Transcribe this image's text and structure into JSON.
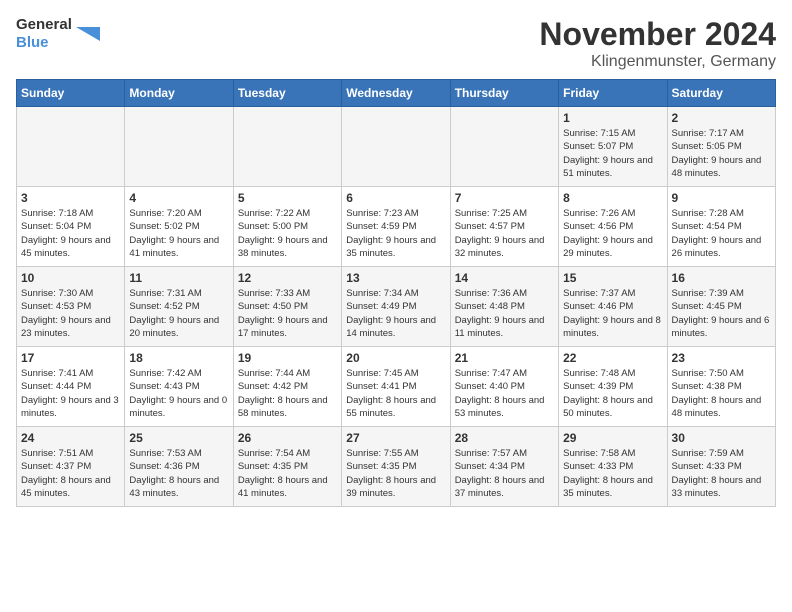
{
  "logo": {
    "general": "General",
    "blue": "Blue"
  },
  "title": "November 2024",
  "subtitle": "Klingenmunster, Germany",
  "weekdays": [
    "Sunday",
    "Monday",
    "Tuesday",
    "Wednesday",
    "Thursday",
    "Friday",
    "Saturday"
  ],
  "weeks": [
    [
      {
        "day": "",
        "info": ""
      },
      {
        "day": "",
        "info": ""
      },
      {
        "day": "",
        "info": ""
      },
      {
        "day": "",
        "info": ""
      },
      {
        "day": "",
        "info": ""
      },
      {
        "day": "1",
        "info": "Sunrise: 7:15 AM\nSunset: 5:07 PM\nDaylight: 9 hours and 51 minutes."
      },
      {
        "day": "2",
        "info": "Sunrise: 7:17 AM\nSunset: 5:05 PM\nDaylight: 9 hours and 48 minutes."
      }
    ],
    [
      {
        "day": "3",
        "info": "Sunrise: 7:18 AM\nSunset: 5:04 PM\nDaylight: 9 hours and 45 minutes."
      },
      {
        "day": "4",
        "info": "Sunrise: 7:20 AM\nSunset: 5:02 PM\nDaylight: 9 hours and 41 minutes."
      },
      {
        "day": "5",
        "info": "Sunrise: 7:22 AM\nSunset: 5:00 PM\nDaylight: 9 hours and 38 minutes."
      },
      {
        "day": "6",
        "info": "Sunrise: 7:23 AM\nSunset: 4:59 PM\nDaylight: 9 hours and 35 minutes."
      },
      {
        "day": "7",
        "info": "Sunrise: 7:25 AM\nSunset: 4:57 PM\nDaylight: 9 hours and 32 minutes."
      },
      {
        "day": "8",
        "info": "Sunrise: 7:26 AM\nSunset: 4:56 PM\nDaylight: 9 hours and 29 minutes."
      },
      {
        "day": "9",
        "info": "Sunrise: 7:28 AM\nSunset: 4:54 PM\nDaylight: 9 hours and 26 minutes."
      }
    ],
    [
      {
        "day": "10",
        "info": "Sunrise: 7:30 AM\nSunset: 4:53 PM\nDaylight: 9 hours and 23 minutes."
      },
      {
        "day": "11",
        "info": "Sunrise: 7:31 AM\nSunset: 4:52 PM\nDaylight: 9 hours and 20 minutes."
      },
      {
        "day": "12",
        "info": "Sunrise: 7:33 AM\nSunset: 4:50 PM\nDaylight: 9 hours and 17 minutes."
      },
      {
        "day": "13",
        "info": "Sunrise: 7:34 AM\nSunset: 4:49 PM\nDaylight: 9 hours and 14 minutes."
      },
      {
        "day": "14",
        "info": "Sunrise: 7:36 AM\nSunset: 4:48 PM\nDaylight: 9 hours and 11 minutes."
      },
      {
        "day": "15",
        "info": "Sunrise: 7:37 AM\nSunset: 4:46 PM\nDaylight: 9 hours and 8 minutes."
      },
      {
        "day": "16",
        "info": "Sunrise: 7:39 AM\nSunset: 4:45 PM\nDaylight: 9 hours and 6 minutes."
      }
    ],
    [
      {
        "day": "17",
        "info": "Sunrise: 7:41 AM\nSunset: 4:44 PM\nDaylight: 9 hours and 3 minutes."
      },
      {
        "day": "18",
        "info": "Sunrise: 7:42 AM\nSunset: 4:43 PM\nDaylight: 9 hours and 0 minutes."
      },
      {
        "day": "19",
        "info": "Sunrise: 7:44 AM\nSunset: 4:42 PM\nDaylight: 8 hours and 58 minutes."
      },
      {
        "day": "20",
        "info": "Sunrise: 7:45 AM\nSunset: 4:41 PM\nDaylight: 8 hours and 55 minutes."
      },
      {
        "day": "21",
        "info": "Sunrise: 7:47 AM\nSunset: 4:40 PM\nDaylight: 8 hours and 53 minutes."
      },
      {
        "day": "22",
        "info": "Sunrise: 7:48 AM\nSunset: 4:39 PM\nDaylight: 8 hours and 50 minutes."
      },
      {
        "day": "23",
        "info": "Sunrise: 7:50 AM\nSunset: 4:38 PM\nDaylight: 8 hours and 48 minutes."
      }
    ],
    [
      {
        "day": "24",
        "info": "Sunrise: 7:51 AM\nSunset: 4:37 PM\nDaylight: 8 hours and 45 minutes."
      },
      {
        "day": "25",
        "info": "Sunrise: 7:53 AM\nSunset: 4:36 PM\nDaylight: 8 hours and 43 minutes."
      },
      {
        "day": "26",
        "info": "Sunrise: 7:54 AM\nSunset: 4:35 PM\nDaylight: 8 hours and 41 minutes."
      },
      {
        "day": "27",
        "info": "Sunrise: 7:55 AM\nSunset: 4:35 PM\nDaylight: 8 hours and 39 minutes."
      },
      {
        "day": "28",
        "info": "Sunrise: 7:57 AM\nSunset: 4:34 PM\nDaylight: 8 hours and 37 minutes."
      },
      {
        "day": "29",
        "info": "Sunrise: 7:58 AM\nSunset: 4:33 PM\nDaylight: 8 hours and 35 minutes."
      },
      {
        "day": "30",
        "info": "Sunrise: 7:59 AM\nSunset: 4:33 PM\nDaylight: 8 hours and 33 minutes."
      }
    ]
  ]
}
